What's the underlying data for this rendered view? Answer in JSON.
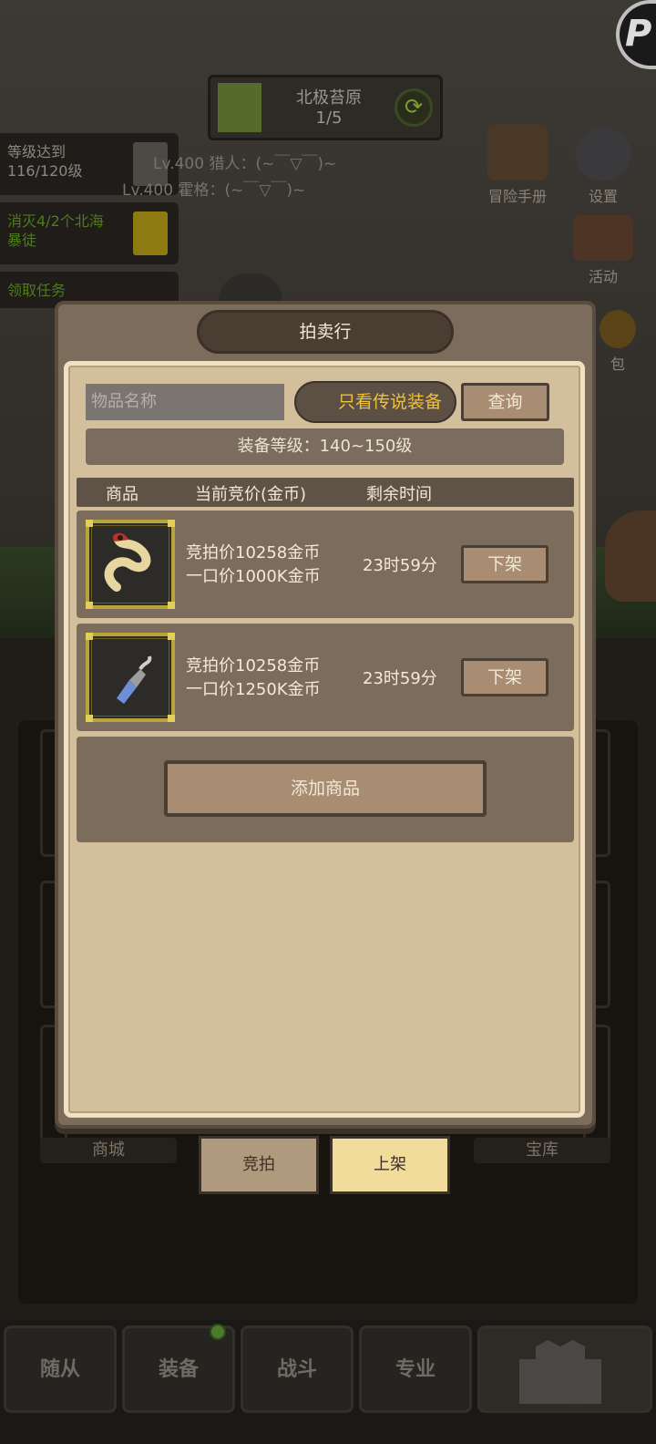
{
  "header": {
    "region_name": "北极苔原",
    "region_progress": "1/5",
    "refresh_icon": "refresh-icon"
  },
  "tasks": [
    {
      "text": "等级达到116/120级"
    },
    {
      "text": "消灭4/2个北海暴徒"
    },
    {
      "text": "领取任务"
    }
  ],
  "hunters": {
    "line1": "Lv.400 猎人：(~￣▽￣)~",
    "line2": "Lv.400 霍格：(~￣▽￣)~"
  },
  "side_menu": {
    "adventure": "冒险手册",
    "settings": "设置",
    "activity": "活动",
    "bag": "包"
  },
  "modal": {
    "title": "拍卖行",
    "search_placeholder": "物品名称",
    "legend_only": "只看传说装备",
    "query": "查询",
    "level_filter": "装备等级：140~150级",
    "columns": [
      "商品",
      "当前竞价(金币)",
      "剩余时间"
    ],
    "rows": [
      {
        "bid": "竞拍价10258金币",
        "buyout": "一口价1000K金币",
        "time": "23时59分",
        "action": "下架",
        "icon": "serpent-icon"
      },
      {
        "bid": "竞拍价10258金币",
        "buyout": "一口价1250K金币",
        "time": "23时59分",
        "action": "下架",
        "icon": "crystal-dagger-icon"
      }
    ],
    "add_item": "添加商品"
  },
  "subtabs": {
    "bid": "竞拍",
    "list": "上架"
  },
  "behind_labels": {
    "shop": "商城",
    "treasury": "宝库"
  },
  "nav": [
    "随从",
    "装备",
    "战斗",
    "专业",
    "主城"
  ],
  "colors": {
    "accent_gold": "#f0c23a",
    "paper": "#d4bf9c",
    "active_tab": "#f1dc9c"
  }
}
